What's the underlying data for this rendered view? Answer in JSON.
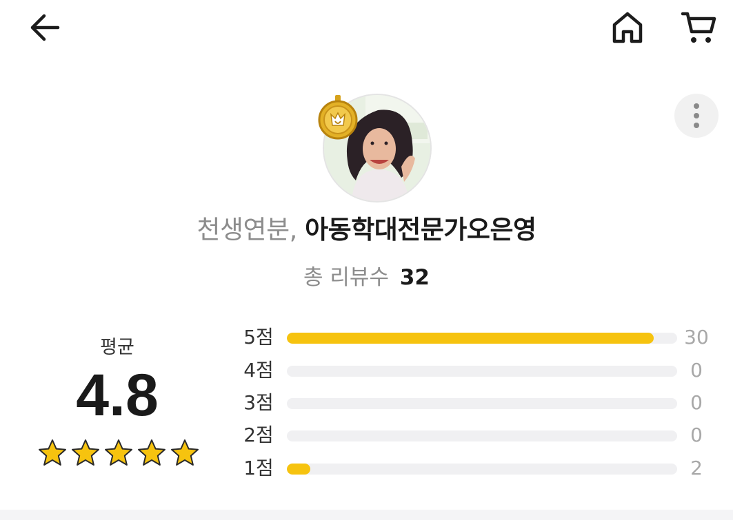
{
  "header": {
    "back_icon": "arrow-left-icon",
    "home_icon": "home-icon",
    "cart_icon": "cart-icon"
  },
  "profile": {
    "avatar": "profile-photo",
    "badge_icon": "gold-medal-badge-icon",
    "more_icon": "vertical-dots-icon",
    "name_prefix": "천생연분,",
    "name": "아동학대전문가오은영",
    "review_label": "총 리뷰수",
    "review_count": "32"
  },
  "summary": {
    "average_label": "평균",
    "average_value": "4.8",
    "star_count": 5,
    "star_color": "#f6c30f"
  },
  "distribution": [
    {
      "label": "5점",
      "count": "30",
      "fraction": 0.94
    },
    {
      "label": "4점",
      "count": "0",
      "fraction": 0
    },
    {
      "label": "3점",
      "count": "0",
      "fraction": 0
    },
    {
      "label": "2점",
      "count": "0",
      "fraction": 0
    },
    {
      "label": "1점",
      "count": "2",
      "fraction": 0.06
    }
  ],
  "colors": {
    "bar_fill": "#f6c30f",
    "bar_track": "#f0f0f2"
  }
}
